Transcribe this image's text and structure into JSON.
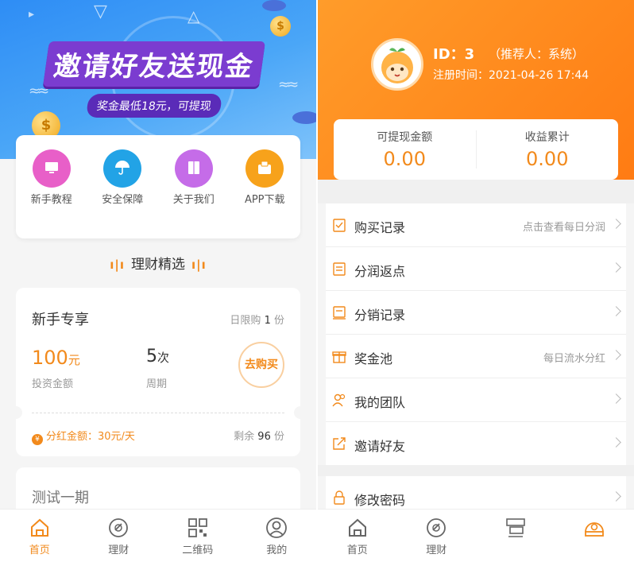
{
  "left": {
    "banner": {
      "title": "邀请好友送现金",
      "subtitle": "奖金最低18元，可提现"
    },
    "quick_links": [
      {
        "label": "新手教程",
        "icon": "monitor-icon",
        "color": "#e85fc8"
      },
      {
        "label": "安全保障",
        "icon": "umbrella-icon",
        "color": "#22a3e6"
      },
      {
        "label": "关于我们",
        "icon": "book-icon",
        "color": "#c56ce8"
      },
      {
        "label": "APP下载",
        "icon": "download-box-icon",
        "color": "#f7a21b"
      }
    ],
    "section_title": "理财精选",
    "product": {
      "name": "新手专享",
      "limit_prefix": "日限购",
      "limit_value": "1",
      "limit_unit": "份",
      "amount_value": "100",
      "amount_unit": "元",
      "amount_label": "投资金额",
      "period_value": "5",
      "period_unit": "次",
      "period_label": "周期",
      "buy_label": "去购买",
      "dividend_text": "分红金额：30元/天",
      "remaining_prefix": "剩余",
      "remaining_value": "96",
      "remaining_unit": "份"
    },
    "product2": {
      "name": "测试一期"
    },
    "tabs": [
      {
        "label": "首页",
        "icon": "home-icon",
        "active": true
      },
      {
        "label": "理财",
        "icon": "finance-icon",
        "active": false
      },
      {
        "label": "二维码",
        "icon": "qrcode-icon",
        "active": false
      },
      {
        "label": "我的",
        "icon": "user-icon",
        "active": false
      }
    ]
  },
  "right": {
    "profile": {
      "id_text": "ID：3",
      "referrer_text": "（推荐人：系统）",
      "register_text": "注册时间：2021-04-26 17:44"
    },
    "stats": [
      {
        "label": "可提现金额",
        "value": "0.00"
      },
      {
        "label": "收益累计",
        "value": "0.00"
      }
    ],
    "menu": [
      {
        "label": "购买记录",
        "hint": "点击查看每日分润",
        "icon": "clipboard-icon"
      },
      {
        "label": "分润返点",
        "hint": "",
        "icon": "list-icon"
      },
      {
        "label": "分销记录",
        "hint": "",
        "icon": "receipt-icon"
      },
      {
        "label": "奖金池",
        "hint": "每日流水分红",
        "icon": "gift-icon"
      },
      {
        "label": "我的团队",
        "hint": "",
        "icon": "team-icon"
      },
      {
        "label": "邀请好友",
        "hint": "",
        "icon": "share-icon"
      }
    ],
    "menu2": [
      {
        "label": "修改密码",
        "hint": "",
        "icon": "lock-icon"
      }
    ],
    "tabs": [
      {
        "label": "首页",
        "icon": "home-icon"
      },
      {
        "label": "理财",
        "icon": "finance-icon"
      },
      {
        "label": "",
        "icon": "qrcode-icon"
      },
      {
        "label": "",
        "icon": "user-icon"
      }
    ]
  },
  "colors": {
    "accent": "#f28a1c",
    "banner_blue": "#3a96f6",
    "header_orange": "#ff8a1e"
  }
}
